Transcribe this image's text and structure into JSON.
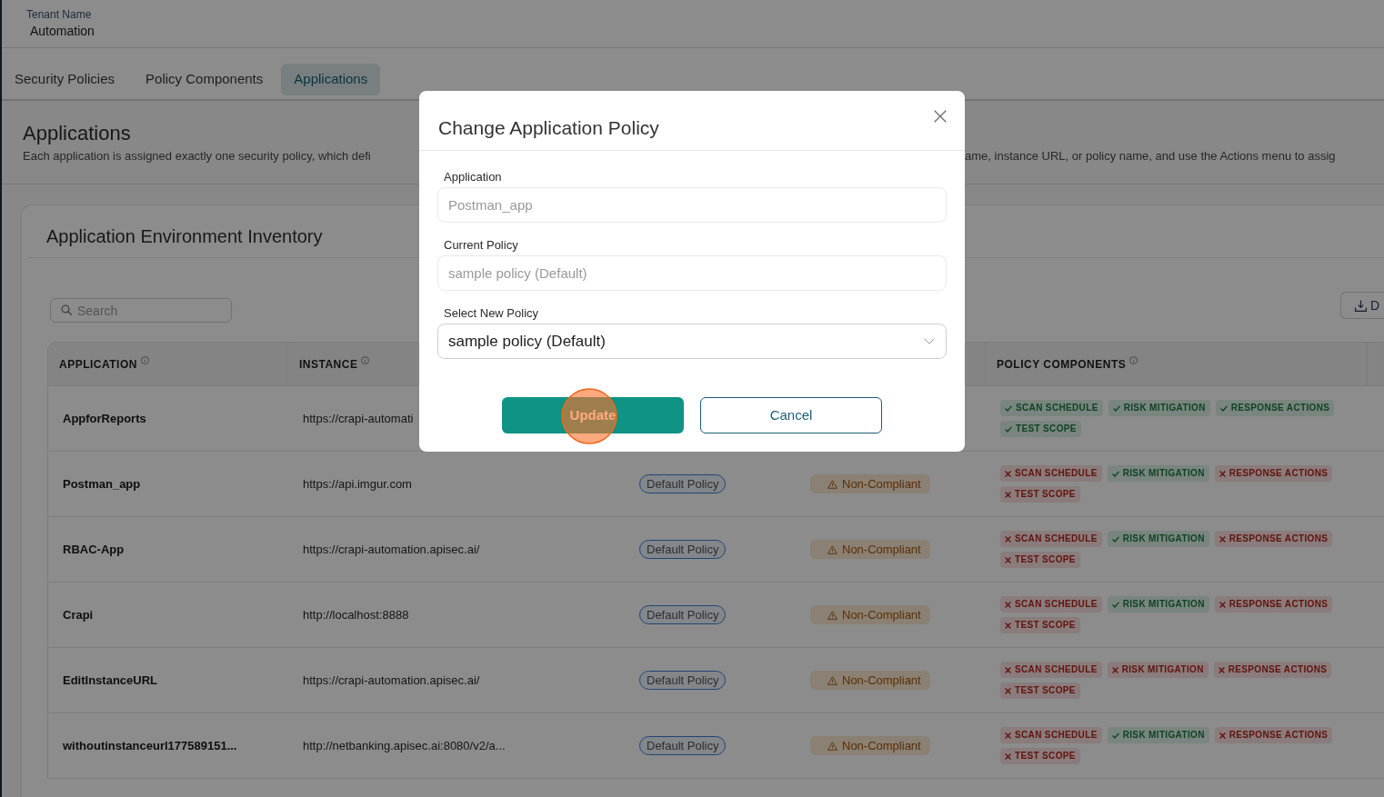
{
  "header": {
    "tenant_label": "Tenant Name",
    "tenant_name": "Automation"
  },
  "tabs": [
    {
      "label": "Security Policies",
      "selected": false
    },
    {
      "label": "Policy Components",
      "selected": false
    },
    {
      "label": "Applications",
      "selected": true
    }
  ],
  "page": {
    "title": "Applications",
    "description": [
      "Each application is assigned exactly one security policy, which defi",
      "ame, instance URL, or policy name, and use the Actions menu to assig"
    ]
  },
  "inventory": {
    "title": "Application Environment Inventory",
    "search": {
      "placeholder": "Search"
    },
    "download_button": {
      "label": "D"
    },
    "table": {
      "columns": {
        "application": "APPLICATION",
        "instance": "INSTANCE",
        "policy_components": "POLICY COMPONENTS"
      },
      "rows": [
        {
          "application": "AppforReports",
          "instance": "https://crapi-automati",
          "policy_components": [
            {
              "label": "SCAN SCHEDULE",
              "met": true
            },
            {
              "label": "RISK MITIGATION",
              "met": true
            },
            {
              "label": "RESPONSE ACTIONS",
              "met": true
            },
            {
              "label": "TEST SCOPE",
              "met": true
            }
          ]
        },
        {
          "application": "Postman_app",
          "instance": "https://api.imgur.com",
          "column_3": "Default Policy",
          "column_4": "Non-Compliant",
          "policy_components": [
            {
              "label": "SCAN SCHEDULE",
              "met": false
            },
            {
              "label": "RISK MITIGATION",
              "met": true
            },
            {
              "label": "RESPONSE ACTIONS",
              "met": false
            },
            {
              "label": "TEST SCOPE",
              "met": false
            }
          ]
        },
        {
          "application": "RBAC-App",
          "instance": "https://crapi-automation.apisec.ai/",
          "column_3": "Default Policy",
          "column_4": "Non-Compliant",
          "policy_components": [
            {
              "label": "SCAN SCHEDULE",
              "met": false
            },
            {
              "label": "RISK MITIGATION",
              "met": true
            },
            {
              "label": "RESPONSE ACTIONS",
              "met": false
            },
            {
              "label": "TEST SCOPE",
              "met": false
            }
          ]
        },
        {
          "application": "Crapi",
          "instance": "http://localhost:8888",
          "column_3": "Default Policy",
          "column_4": "Non-Compliant",
          "policy_components": [
            {
              "label": "SCAN SCHEDULE",
              "met": false
            },
            {
              "label": "RISK MITIGATION",
              "met": true
            },
            {
              "label": "RESPONSE ACTIONS",
              "met": false
            },
            {
              "label": "TEST SCOPE",
              "met": false
            }
          ]
        },
        {
          "application": "EditInstanceURL",
          "instance": "https://crapi-automation.apisec.ai/",
          "column_3": "Default Policy",
          "column_4": "Non-Compliant",
          "policy_components": [
            {
              "label": "SCAN SCHEDULE",
              "met": false
            },
            {
              "label": "RISK MITIGATION",
              "met": false
            },
            {
              "label": "RESPONSE ACTIONS",
              "met": false
            },
            {
              "label": "TEST SCOPE",
              "met": false
            }
          ]
        },
        {
          "application": "withoutinstanceurl177589151...",
          "instance": "http://netbanking.apisec.ai:8080/v2/a...",
          "column_3": "Default Policy",
          "column_4": "Non-Compliant",
          "policy_components": [
            {
              "label": "SCAN SCHEDULE",
              "met": false
            },
            {
              "label": "RISK MITIGATION",
              "met": true
            },
            {
              "label": "RESPONSE ACTIONS",
              "met": false
            },
            {
              "label": "TEST SCOPE",
              "met": false
            }
          ]
        }
      ]
    }
  },
  "dialog": {
    "title": "Change Application Policy",
    "fields": [
      {
        "label": "Application",
        "value": "Postman_app",
        "kind": "text",
        "disabled": true
      },
      {
        "label": "Current Policy",
        "value": "sample policy (Default)",
        "kind": "text",
        "disabled": true
      },
      {
        "label": "Select New Policy",
        "value": "sample policy (Default)",
        "kind": "select",
        "disabled": false
      }
    ],
    "buttons": [
      {
        "label": "Update",
        "kind": "primary",
        "clicked": true
      },
      {
        "label": "Cancel",
        "kind": "secondary",
        "clicked": false
      }
    ]
  }
}
